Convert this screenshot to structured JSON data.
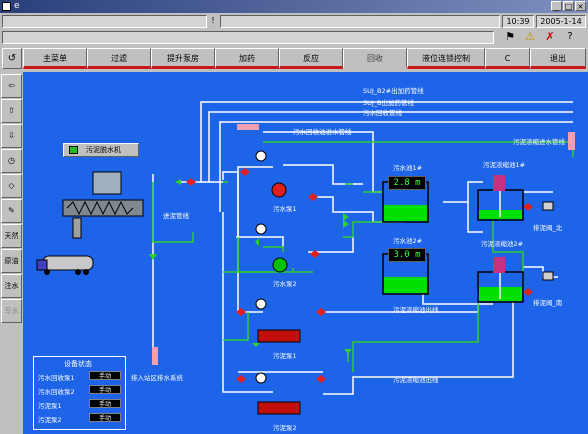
{
  "window": {
    "title": "e"
  },
  "status": {
    "time": "10:39",
    "date": "2005-1-14",
    "info_mark": "!"
  },
  "nav": {
    "items": [
      "主菜单",
      "过滤",
      "提升泵房",
      "加药",
      "反应",
      "回收",
      "液位连锁控制",
      "C",
      "退出"
    ]
  },
  "toolbar": {
    "zhongpeng": "天然",
    "yuanyou": "原油",
    "zhushui": "注水",
    "disabled": "写水"
  },
  "pipes": {
    "line1": "SUJ_B2#出加药管线",
    "line2": "SUJ_B出加药管线",
    "line3": "污水回收管线",
    "line4": "污水回收油进水管线",
    "line5": "污泥浓缩进水管线",
    "line6": "进泥管线",
    "line7": "污泥浓缩池出线",
    "line8": "污泥浓缩池出线",
    "line9": "排入站区排水系统"
  },
  "equipment": {
    "dewater": "污泥脱水机",
    "pump1": "污水泵1",
    "pump2": "污水泵2",
    "sludge_pump1": "污泥泵1",
    "sludge_pump2": "污泥泵2",
    "pool1": "污水池1#",
    "pool2": "污水池2#",
    "conc1": "污泥浓缩池1#",
    "conc2": "污泥浓缩池2#",
    "valve_n": "排泥阀_北",
    "valve_s": "排泥阀_南"
  },
  "readings": {
    "pool1_level": "2.8 m",
    "pool2_level": "3.0 m"
  },
  "device_status": {
    "title": "设备状态",
    "rows": [
      {
        "name": "污水回收泵1",
        "state": "手动"
      },
      {
        "name": "污水回收泵2",
        "state": "手动"
      },
      {
        "name": "污泥泵1",
        "state": "手动"
      },
      {
        "name": "污泥泵2",
        "state": "手动"
      }
    ]
  },
  "colors": {
    "background": "#1e64e8",
    "pipe": "#ffffff",
    "flow": "#2fd02f",
    "valve": "#e02020",
    "water": "#00e000"
  }
}
